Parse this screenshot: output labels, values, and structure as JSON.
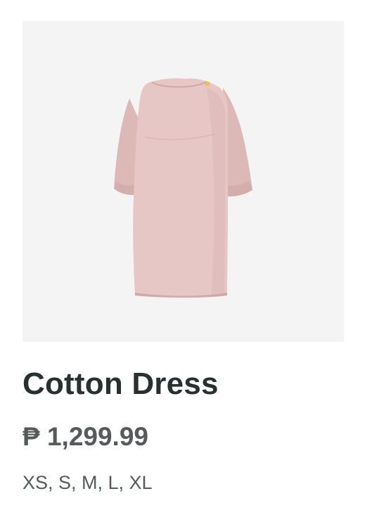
{
  "product": {
    "image_alt": "Cotton Dress product photo",
    "image_bg": "#f4f4f4",
    "dress_color": "#e6c7c5",
    "name": "Cotton Dress",
    "price": "₱ 1,299.99",
    "sizes": "XS, S, M, L, XL"
  },
  "colors": {
    "title": "#283130",
    "secondary_text": "#555a5a"
  }
}
